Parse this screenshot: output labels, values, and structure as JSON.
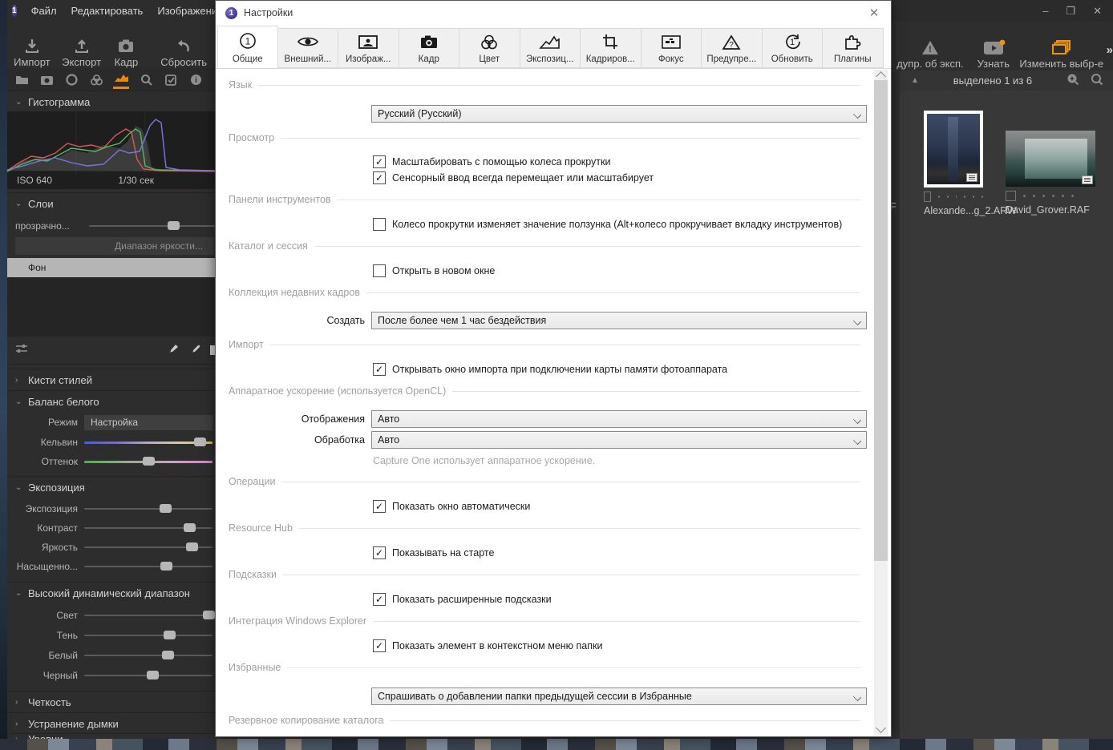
{
  "accent_orange": "#e8890c",
  "menu": {
    "items": [
      "Файл",
      "Редактировать",
      "Изображение"
    ]
  },
  "main_toolbar": {
    "import": "Импорт",
    "export": "Экспорт",
    "frame": "Кадр",
    "reset": "Сбросить"
  },
  "left_panel": {
    "histogram": {
      "title": "Гистограмма",
      "iso": "ISO 640",
      "shutter": "1/30 сек"
    },
    "layers": {
      "title": "Слои",
      "opacity_label": "прозрачно...",
      "range_button": "Диапазон яркости...",
      "background_layer": "Фон"
    },
    "style_brushes_title": "Кисти стилей",
    "white_balance": {
      "title": "Баланс белого",
      "mode_label": "Режим",
      "mode_value": "Настройка",
      "kelvin_label": "Кельвин",
      "tint_label": "Оттенок"
    },
    "exposure": {
      "title": "Экспозиция",
      "sliders": [
        {
          "label": "Экспозиция",
          "pos": 63
        },
        {
          "label": "Контраст",
          "pos": 82
        },
        {
          "label": "Яркость",
          "pos": 84
        },
        {
          "label": "Насыщенно...",
          "pos": 64
        }
      ]
    },
    "hdr": {
      "title": "Высокий динамический диапазон",
      "sliders": [
        {
          "label": "Свет",
          "pos": 97
        },
        {
          "label": "Тень",
          "pos": 66
        },
        {
          "label": "Белый",
          "pos": 65
        },
        {
          "label": "Черный",
          "pos": 53
        }
      ]
    },
    "clarity_title": "Четкость",
    "dehaze_title": "Устранение дымки",
    "levels_title": "Уровни"
  },
  "dialog": {
    "title": "Настройки",
    "close": "✕",
    "tabs": [
      {
        "label": "Общие",
        "active": true
      },
      {
        "label": "Внешний..."
      },
      {
        "label": "Изображ..."
      },
      {
        "label": "Кадр"
      },
      {
        "label": "Цвет"
      },
      {
        "label": "Экспозиц..."
      },
      {
        "label": "Кадриров..."
      },
      {
        "label": "Фокус"
      },
      {
        "label": "Предупре..."
      },
      {
        "label": "Обновить"
      },
      {
        "label": "Плагины"
      }
    ],
    "sections": {
      "language": "Язык",
      "view": "Просмотр",
      "toolbars": "Панели инструментов",
      "catalog_session": "Каталог и сессия",
      "recent_captures": "Коллекция недавних кадров",
      "import": "Импорт",
      "hardware": "Аппаратное ускорение (используется OpenCL)",
      "operations": "Операции",
      "resource_hub": "Resource Hub",
      "tooltips": "Подсказки",
      "explorer": "Интеграция Windows Explorer",
      "favorites": "Избранные",
      "backup": "Резервное копирование каталога"
    },
    "fields": {
      "language_value": "Русский (Русский)",
      "create_label": "Создать",
      "create_value": "После более чем 1 час бездействия",
      "display_label": "Отображения",
      "display_value": "Авто",
      "processing_label": "Обработка",
      "processing_value": "Авто",
      "hardware_caption": "Capture One использует аппаратное ускорение.",
      "favorites_value": "Спрашивать о добавлении папки предыдущей сессии в Избранные"
    },
    "checkboxes": [
      {
        "label": "Масштабировать с помощью колеса прокрутки",
        "mark": "✓"
      },
      {
        "label": "Сенсорный ввод всегда перемещает или масштабирует",
        "mark": "✓"
      },
      {
        "label": "Колесо прокрутки изменяет значение ползунка (Alt+колесо прокручивает вкладку инструментов)",
        "mark": ""
      },
      {
        "label": "Открыть в новом окне",
        "mark": ""
      },
      {
        "label": "Открывать окно импорта при подключении карты памяти фотоаппарата",
        "mark": "✓"
      },
      {
        "label": "Показать окно автоматически",
        "mark": "✓"
      },
      {
        "label": "Показывать на старте",
        "mark": "✓"
      },
      {
        "label": "Показать расширенные подсказки",
        "mark": "✓"
      },
      {
        "label": "Показать элемент в контекстном меню папки",
        "mark": "✓"
      }
    ]
  },
  "right_panel": {
    "window_controls": {
      "minimize": "–",
      "maximize": "❐",
      "close": "✕"
    },
    "toolbar": {
      "exposure_warning": "дупр. об эксп.",
      "learn": "Узнать",
      "edit_selected": "Изменить выбр-е",
      "overflow": "»"
    },
    "browser_header": {
      "selected_text": "выделено 1 из 6"
    },
    "cut_filename_fragment": "F",
    "thumbnails": [
      {
        "filename": "Alexande...g_2.ARW",
        "selected": true
      },
      {
        "filename": "David_Grover.RAF",
        "selected": false
      }
    ]
  }
}
